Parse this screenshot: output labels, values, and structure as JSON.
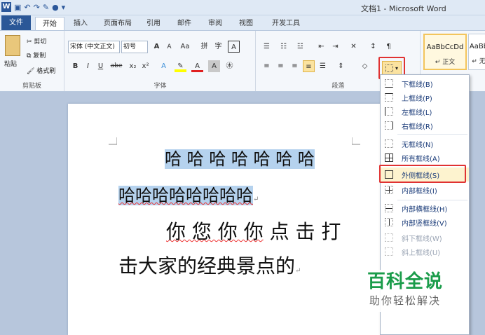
{
  "window": {
    "title": "文档1 - Microsoft Word"
  },
  "tabs": [
    {
      "label": "文件"
    },
    {
      "label": "开始"
    },
    {
      "label": "插入"
    },
    {
      "label": "页面布局"
    },
    {
      "label": "引用"
    },
    {
      "label": "邮件"
    },
    {
      "label": "审阅"
    },
    {
      "label": "视图"
    },
    {
      "label": "开发工具"
    }
  ],
  "clipboard": {
    "paste": "粘贴",
    "cut": "剪切",
    "copy": "复制",
    "format_painter": "格式刷",
    "group": "剪贴板"
  },
  "font": {
    "name": "宋体 (中文正文)",
    "size": "初号",
    "grow": "A",
    "shrink": "A",
    "case": "Aa",
    "bold": "B",
    "italic": "I",
    "underline": "U",
    "strike": "abe",
    "sub": "x₂",
    "sup": "x²",
    "group": "字体"
  },
  "paragraph": {
    "group": "段落"
  },
  "styles": [
    {
      "sample": "AaBbCcDd",
      "name": "↵ 正文"
    },
    {
      "sample": "AaBb",
      "name": "↵ 无"
    }
  ],
  "doc": {
    "line1": "哈 哈 哈 哈 哈 哈 哈",
    "line2": "哈哈哈哈哈哈哈哈",
    "line3a": "你 您 你 你",
    "line3b": " 点 击 打",
    "line4": "击大家的经典景点的"
  },
  "border_menu": [
    {
      "label": "下框线(B)",
      "disabled": false
    },
    {
      "label": "上框线(P)",
      "disabled": false
    },
    {
      "label": "左框线(L)",
      "disabled": false
    },
    {
      "label": "右框线(R)",
      "disabled": false
    },
    {
      "label": "无框线(N)",
      "disabled": false
    },
    {
      "label": "所有框线(A)",
      "disabled": false
    },
    {
      "label": "外侧框线(S)",
      "disabled": false,
      "highlighted": true
    },
    {
      "label": "内部框线(I)",
      "disabled": false
    },
    {
      "label": "内部横框线(H)",
      "disabled": false
    },
    {
      "label": "内部竖框线(V)",
      "disabled": false
    },
    {
      "label": "斜下框线(W)",
      "disabled": true
    },
    {
      "label": "斜上框线(U)",
      "disabled": true
    }
  ],
  "watermark": {
    "title": "百科全说",
    "subtitle": "助你轻松解决"
  },
  "colors": {
    "accent": "#2b5797",
    "highlight_red": "#e03232",
    "selection": "#b5d2ee"
  }
}
